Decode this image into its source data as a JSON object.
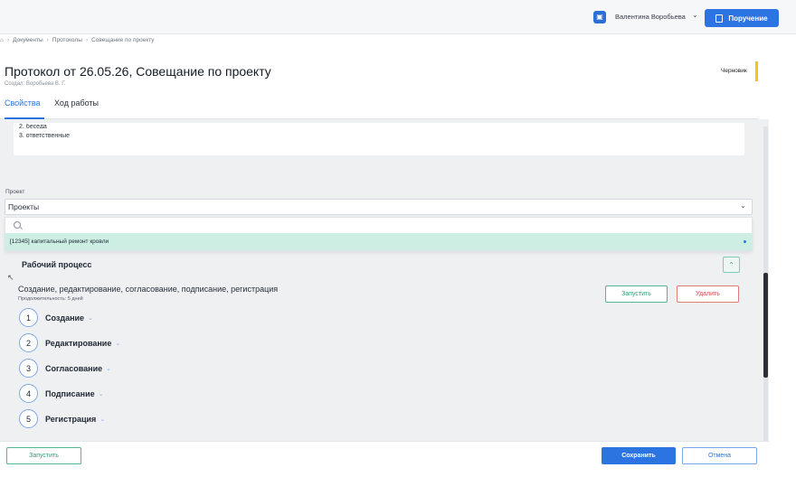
{
  "header": {
    "user_name": "Валентина Воробьева",
    "assign_label": "Поручение"
  },
  "breadcrumbs": [
    "Документы",
    "Протоколы",
    "Совещание по проекту"
  ],
  "document": {
    "title": "Протокол от 26.05.26, Совещание по проекту",
    "created_by": "Создал: Воробьева В. Г.",
    "status": "Черновик"
  },
  "tabs": [
    "Свойства",
    "Ход работы"
  ],
  "description_lines": [
    "2. беседа",
    "3. ответственные"
  ],
  "project": {
    "label": "Проект",
    "placeholder": "Проекты",
    "options": [
      "[12345] капитальный ремонт кровли"
    ]
  },
  "workflow": {
    "title": "Рабочий процесс",
    "stages_text": "Создание, редактирование, согласование, подписание, регистрация",
    "duration": "Продолжительность: 5 дней",
    "run_label": "Запустить",
    "delete_label": "Удалить",
    "steps": [
      {
        "num": "1",
        "label": "Создание"
      },
      {
        "num": "2",
        "label": "Редактирование"
      },
      {
        "num": "3",
        "label": "Согласование"
      },
      {
        "num": "4",
        "label": "Подписание"
      },
      {
        "num": "5",
        "label": "Регистрация"
      }
    ]
  },
  "footer": {
    "run_label": "Запустить",
    "save_label": "Сохранить",
    "cancel_label": "Отмена"
  },
  "colors": {
    "accent": "#2b74e2",
    "success": "#2c9c76",
    "danger": "#d34b4b",
    "draft": "#f5c518"
  }
}
